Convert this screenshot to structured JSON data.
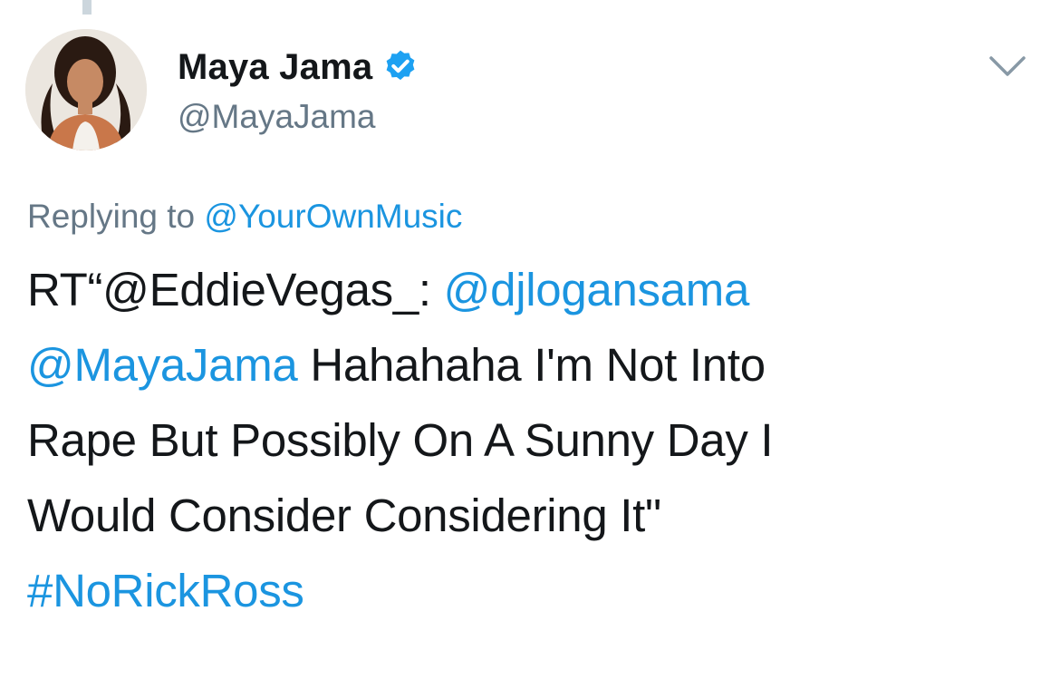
{
  "author": {
    "display_name": "Maya Jama",
    "handle": "@MayaJama",
    "verified_icon": "verified-badge-icon",
    "avatar": "profile-photo"
  },
  "menu_icon": "chevron-down-icon",
  "reply": {
    "prefix": "Replying to",
    "to_handle": "@YourOwnMusic"
  },
  "tweet": {
    "line1_text": "RT“@EddieVegas_: ",
    "line1_mention": "@djlogansama",
    "line2_mention": "@MayaJama",
    "line2_text": " Hahahaha I'm Not Into",
    "line3_text": "Rape But Possibly On A Sunny Day I",
    "line4_text": "Would Consider Considering It\"",
    "hashtag": "#NoRickRoss"
  },
  "colors": {
    "link": "#1b95e0",
    "secondary_text": "#657786",
    "primary_text": "#14171a",
    "verified": "#1da1f2"
  }
}
